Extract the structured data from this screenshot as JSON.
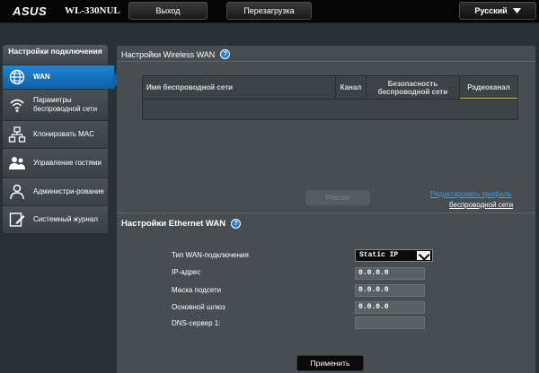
{
  "header": {
    "brand": "ASUS",
    "model": "WL-330NUL",
    "logout_label": "Выход",
    "reboot_label": "Перезагрузка",
    "language": "Русский"
  },
  "sidebar": {
    "title": "Настройки подключения",
    "items": [
      {
        "label": "WAN",
        "icon": "globe-icon",
        "active": true
      },
      {
        "label": "Параметры беспроводной сети",
        "icon": "wifi-icon"
      },
      {
        "label": "Клонировать MAC",
        "icon": "network-icon"
      },
      {
        "label": "Управление гостями",
        "icon": "guests-icon"
      },
      {
        "label": "Администри-рование",
        "icon": "admin-icon"
      },
      {
        "label": "Системный журнал",
        "icon": "log-icon"
      }
    ]
  },
  "wireless_wan": {
    "title": "Настройки Wireless WAN",
    "columns": [
      "Имя беспроводной сети",
      "Канал",
      "Безопасность беспроводной сети",
      "Радиоканал"
    ],
    "rescan_label": "Rescan",
    "edit_profile_link": "Редактировать профиль",
    "edit_profile_link2": "беспроводной сети"
  },
  "ethernet_wan": {
    "title": "Настройки Ethernet WAN",
    "fields": {
      "wan_type_label": "Тип WAN-подключения",
      "wan_type_value": "Static IP",
      "ip_label": "IP-адрес",
      "ip_value": "0.0.0.0",
      "mask_label": "Маска подсети",
      "mask_value": "0.0.0.0",
      "gateway_label": "Основной шлюз",
      "gateway_value": "0.0.0.0",
      "dns_label": "DNS-сервер 1:",
      "dns_value": ""
    },
    "apply_label": "Применить"
  },
  "colors": {
    "accent": "#1c86d0",
    "background": "#2b3034",
    "panel": "#474d51"
  }
}
